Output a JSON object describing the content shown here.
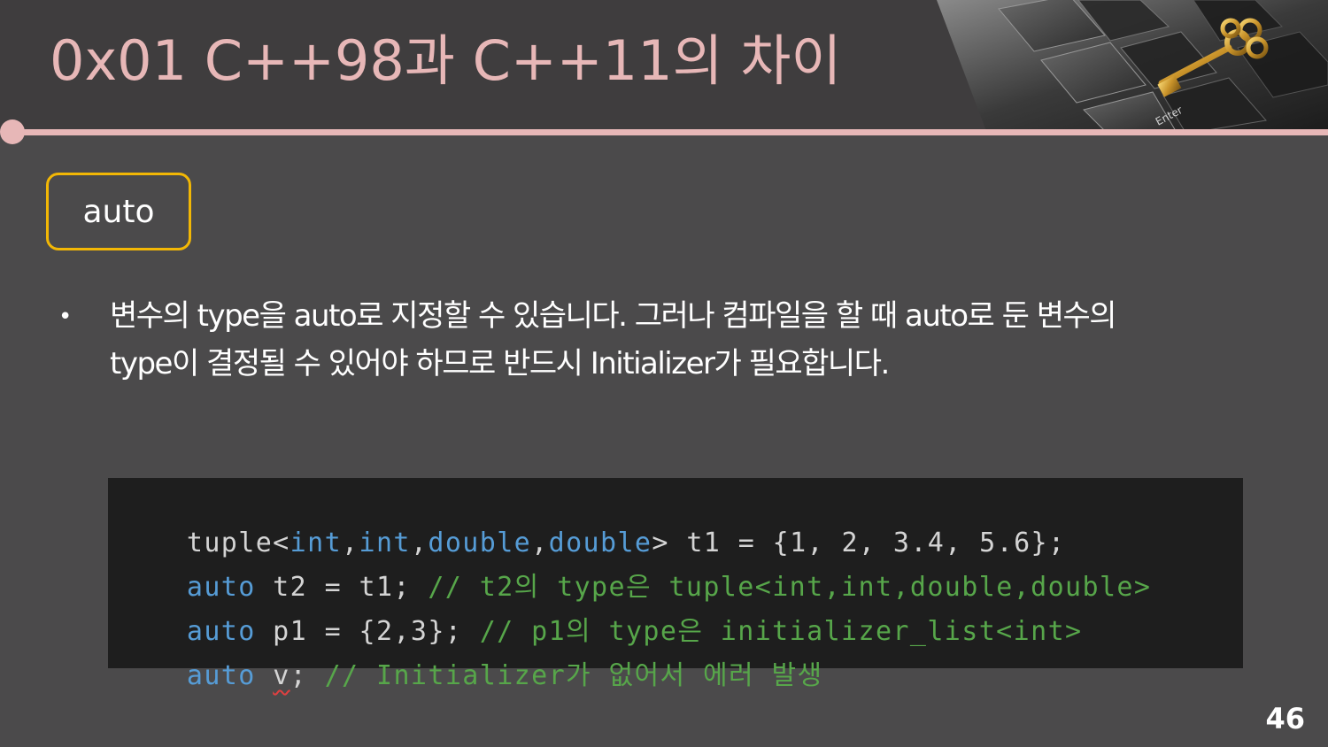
{
  "slide": {
    "title": "0x01  C++98과 C++11의 차이",
    "page_number": "46",
    "keyword": "auto",
    "bullet_symbol": "•",
    "bullet_lines": [
      "변수의 type을 auto로 지정할 수 있습니다. 그러나 컴파일을 할 때 auto로 둔 변수의",
      "type이 결정될 수 있어야 하므로 반드시 Initializer가 필요합니다."
    ]
  },
  "photo": {
    "key_label": "Enter"
  },
  "code": {
    "lines": [
      [
        {
          "t": "tuple<",
          "c": "plain"
        },
        {
          "t": "int",
          "c": "kw"
        },
        {
          "t": ",",
          "c": "plain"
        },
        {
          "t": "int",
          "c": "kw"
        },
        {
          "t": ",",
          "c": "plain"
        },
        {
          "t": "double",
          "c": "kw"
        },
        {
          "t": ",",
          "c": "plain"
        },
        {
          "t": "double",
          "c": "kw"
        },
        {
          "t": "> t1 = {1, 2, 3.4, 5.6};",
          "c": "plain"
        }
      ],
      [
        {
          "t": "auto",
          "c": "kw"
        },
        {
          "t": " t2 = t1; ",
          "c": "plain"
        },
        {
          "t": "// t2의 type은 tuple<int,int,double,double>",
          "c": "cm"
        }
      ],
      [
        {
          "t": "auto",
          "c": "kw"
        },
        {
          "t": " p1 = {2,3}; ",
          "c": "plain"
        },
        {
          "t": "// p1의 type은 initializer_list<int>",
          "c": "cm"
        }
      ],
      [
        {
          "t": "auto",
          "c": "kw"
        },
        {
          "t": " ",
          "c": "plain"
        },
        {
          "t": "v",
          "c": "err"
        },
        {
          "t": "; ",
          "c": "plain"
        },
        {
          "t": "// Initializer가 없어서 에러 발생",
          "c": "cm"
        }
      ]
    ]
  },
  "colors": {
    "background": "#4b4a4b",
    "header_band": "#3f3d3e",
    "accent_pink": "#e7b7b7",
    "keyword_border": "#f2b705",
    "code_bg": "#1e1e1e",
    "code_keyword": "#569cd6",
    "code_comment": "#57a64a",
    "code_plain": "#d4d4d4"
  }
}
